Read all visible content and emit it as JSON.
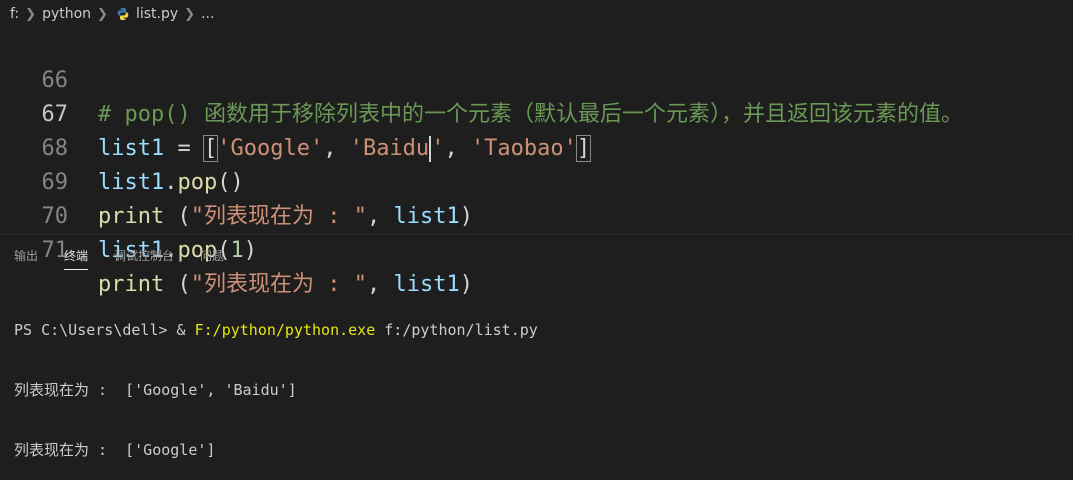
{
  "breadcrumb": {
    "drive": "f:",
    "folder": "python",
    "file": "list.py",
    "more": "..."
  },
  "editor": {
    "lines": [
      {
        "number": "66",
        "comment": "# pop() 函数用于移除列表中的一个元素（默认最后一个元素），并且返回该元素的值。"
      },
      {
        "number": "67",
        "var": "list1",
        "eq": " = ",
        "open": "[",
        "s1": "'Google'",
        "comma1": ", ",
        "s2a": "'Baidu",
        "s2b": "'",
        "comma2": ", ",
        "s3": "'Taobao'",
        "close": "]"
      },
      {
        "number": "68",
        "var": "list1",
        "dot": ".",
        "fn": "pop",
        "args": "()"
      },
      {
        "number": "69",
        "fn": "print",
        "open": " (",
        "str": "\"列表现在为 : \"",
        "comma": ", ",
        "var": "list1",
        "close": ")"
      },
      {
        "number": "70",
        "var": "list1",
        "dot": ".",
        "fn": "pop",
        "open": "(",
        "num": "1",
        "close": ")"
      },
      {
        "number": "71",
        "fn": "print",
        "open": " (",
        "str": "\"列表现在为 : \"",
        "comma": ", ",
        "var": "list1",
        "close": ")"
      }
    ]
  },
  "panel": {
    "tabs": [
      "输出",
      "终端",
      "调试控制台",
      "问题"
    ],
    "active_tab": "终端"
  },
  "terminal": {
    "prompt": "PS C:\\Users\\dell> & ",
    "exe": "F:/python/python.exe",
    "script": " f:/python/list.py",
    "output1": "列表现在为 :  ['Google', 'Baidu']",
    "output2": "列表现在为 :  ['Google']"
  }
}
